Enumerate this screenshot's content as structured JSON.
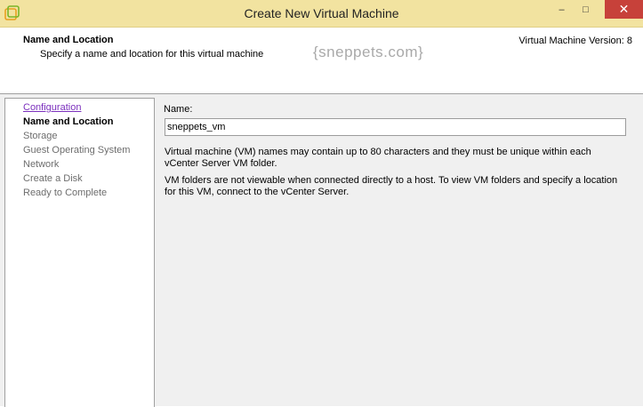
{
  "window": {
    "title": "Create New Virtual Machine",
    "controls": {
      "minimize": "–",
      "maximize": "□",
      "close": "✕"
    }
  },
  "header": {
    "title": "Name and Location",
    "subtitle": "Specify a name and location for this virtual machine",
    "version": "Virtual Machine Version: 8",
    "watermark": "{sneppets.com}"
  },
  "steps": [
    {
      "label": "Configuration",
      "state": "link"
    },
    {
      "label": "Name and Location",
      "state": "current"
    },
    {
      "label": "Storage",
      "state": "disabled"
    },
    {
      "label": "Guest Operating System",
      "state": "disabled"
    },
    {
      "label": "Network",
      "state": "disabled"
    },
    {
      "label": "Create a Disk",
      "state": "disabled"
    },
    {
      "label": "Ready to Complete",
      "state": "disabled"
    }
  ],
  "form": {
    "name_label": "Name:",
    "name_value": "sneppets_vm",
    "help_text_1": "Virtual machine (VM) names may contain up to 80 characters and they must be unique within each vCenter Server VM folder.",
    "help_text_2": "VM folders are not viewable when connected directly to a host. To view VM folders and specify a location for this VM, connect to the vCenter Server."
  },
  "colors": {
    "titlebar": "#f2e3a0",
    "close_button": "#c7413a",
    "link": "#7b2fbd",
    "panel_bg": "#f0f0f0"
  }
}
